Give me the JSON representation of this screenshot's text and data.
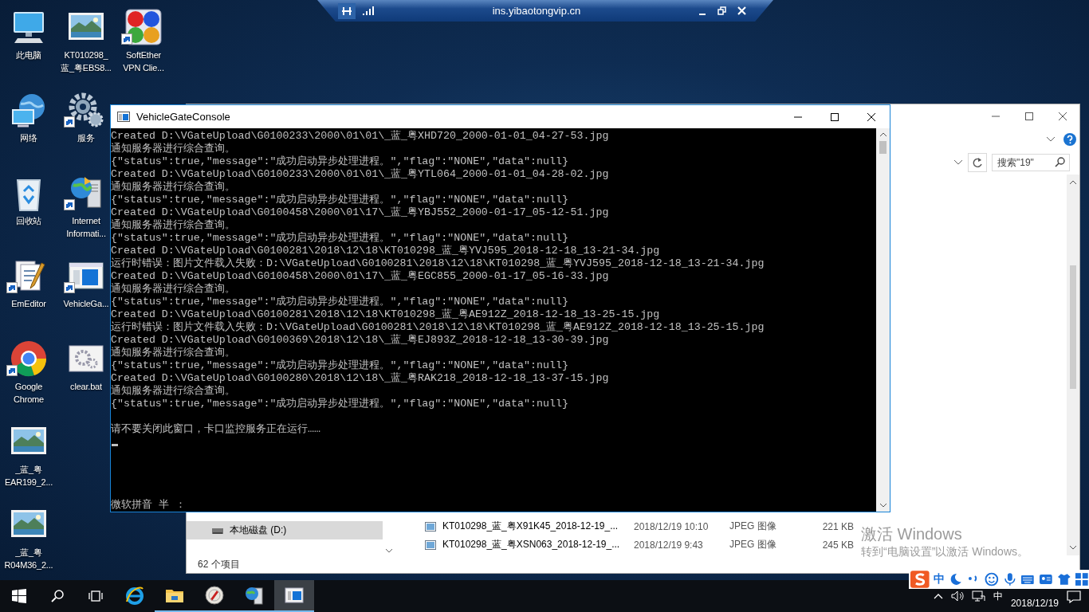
{
  "remote_bar": {
    "title": "ins.yibaotongvip.cn"
  },
  "desktop_columns": [
    {
      "icons": [
        {
          "label": "此电脑",
          "kind": "computer",
          "shortcut": false
        },
        {
          "label": "网络",
          "kind": "network",
          "shortcut": false
        },
        {
          "label": "回收站",
          "kind": "recycle",
          "shortcut": false
        },
        {
          "label": "EmEditor",
          "kind": "editor",
          "shortcut": true
        },
        {
          "label": "Google\nChrome",
          "kind": "chrome",
          "shortcut": true
        },
        {
          "label": "_蓝_粤\nEAR199_2...",
          "kind": "thumbnail",
          "shortcut": false
        },
        {
          "label": "_蓝_粤\nR04M36_2...",
          "kind": "thumbnail",
          "shortcut": false
        }
      ]
    },
    {
      "icons": [
        {
          "label": "KT010298_\n蓝_粤EBS8...",
          "kind": "thumbnail",
          "shortcut": false
        },
        {
          "label": "服务",
          "kind": "gears",
          "shortcut": true
        },
        {
          "label": "Internet\nInformati...",
          "kind": "server",
          "shortcut": true
        },
        {
          "label": "VehicleGa...",
          "kind": "appwindow",
          "shortcut": true
        },
        {
          "label": "clear.bat",
          "kind": "batch",
          "shortcut": false
        }
      ]
    },
    {
      "icons": [
        {
          "label": "SoftEther\nVPN Clie...",
          "kind": "vpn",
          "shortcut": true
        }
      ]
    }
  ],
  "explorer": {
    "search": {
      "placeholder": "搜索\"19\""
    },
    "nav_items": [
      {
        "label": "本地磁盘 (D:)",
        "selected": true
      }
    ],
    "files": [
      {
        "name": "KT010298_蓝_粤X91K45_2018-12-19_...",
        "date": "2018/12/19 10:10",
        "type": "JPEG 图像",
        "size": "221 KB"
      },
      {
        "name": "KT010298_蓝_粤XSN063_2018-12-19_...",
        "date": "2018/12/19 9:43",
        "type": "JPEG 图像",
        "size": "245 KB"
      }
    ],
    "status": "62 个项目"
  },
  "console": {
    "title": "VehicleGateConsole",
    "lines": [
      "Created D:\\VGateUpload\\G0100233\\2000\\01\\01\\_蓝_粤XHD720_2000-01-01_04-27-53.jpg",
      "通知服务器进行综合查询。",
      "{\"status\":true,\"message\":\"成功启动异步处理进程。\",\"flag\":\"NONE\",\"data\":null}",
      "Created D:\\VGateUpload\\G0100233\\2000\\01\\01\\_蓝_粤YTL064_2000-01-01_04-28-02.jpg",
      "通知服务器进行综合查询。",
      "{\"status\":true,\"message\":\"成功启动异步处理进程。\",\"flag\":\"NONE\",\"data\":null}",
      "Created D:\\VGateUpload\\G0100458\\2000\\01\\17\\_蓝_粤YBJ552_2000-01-17_05-12-51.jpg",
      "通知服务器进行综合查询。",
      "{\"status\":true,\"message\":\"成功启动异步处理进程。\",\"flag\":\"NONE\",\"data\":null}",
      "Created D:\\VGateUpload\\G0100281\\2018\\12\\18\\KT010298_蓝_粤YVJ595_2018-12-18_13-21-34.jpg",
      "运行时错误：图片文件载入失败：D:\\VGateUpload\\G0100281\\2018\\12\\18\\KT010298_蓝_粤YVJ595_2018-12-18_13-21-34.jpg",
      "Created D:\\VGateUpload\\G0100458\\2000\\01\\17\\_蓝_粤EGC855_2000-01-17_05-16-33.jpg",
      "通知服务器进行综合查询。",
      "{\"status\":true,\"message\":\"成功启动异步处理进程。\",\"flag\":\"NONE\",\"data\":null}",
      "Created D:\\VGateUpload\\G0100281\\2018\\12\\18\\KT010298_蓝_粤AE912Z_2018-12-18_13-25-15.jpg",
      "运行时错误：图片文件载入失败：D:\\VGateUpload\\G0100281\\2018\\12\\18\\KT010298_蓝_粤AE912Z_2018-12-18_13-25-15.jpg",
      "Created D:\\VGateUpload\\G0100369\\2018\\12\\18\\_蓝_粤EJ893Z_2018-12-18_13-30-39.jpg",
      "通知服务器进行综合查询。",
      "{\"status\":true,\"message\":\"成功启动异步处理进程。\",\"flag\":\"NONE\",\"data\":null}",
      "Created D:\\VGateUpload\\G0100280\\2018\\12\\18\\_蓝_粤RAK218_2018-12-18_13-37-15.jpg",
      "通知服务器进行综合查询。",
      "{\"status\":true,\"message\":\"成功启动异步处理进程。\",\"flag\":\"NONE\",\"data\":null}"
    ],
    "notice": "请不要关闭此窗口，卡口监控服务正在运行……",
    "ime_status": "微软拼音 半 ："
  },
  "activation": {
    "title": "激活 Windows",
    "message": "转到“电脑设置”以激活 Windows。"
  },
  "ime_bar": {
    "mode": "中"
  },
  "taskbar": {
    "apps": [
      {
        "kind": "ie",
        "active": false,
        "running": false
      },
      {
        "kind": "folder",
        "active": false,
        "running": true
      },
      {
        "kind": "compass",
        "active": false,
        "running": true
      },
      {
        "kind": "server",
        "active": false,
        "running": true
      },
      {
        "kind": "console",
        "active": true,
        "running": true
      }
    ],
    "tray": {
      "input": "中",
      "date": "2018/12/19"
    }
  }
}
